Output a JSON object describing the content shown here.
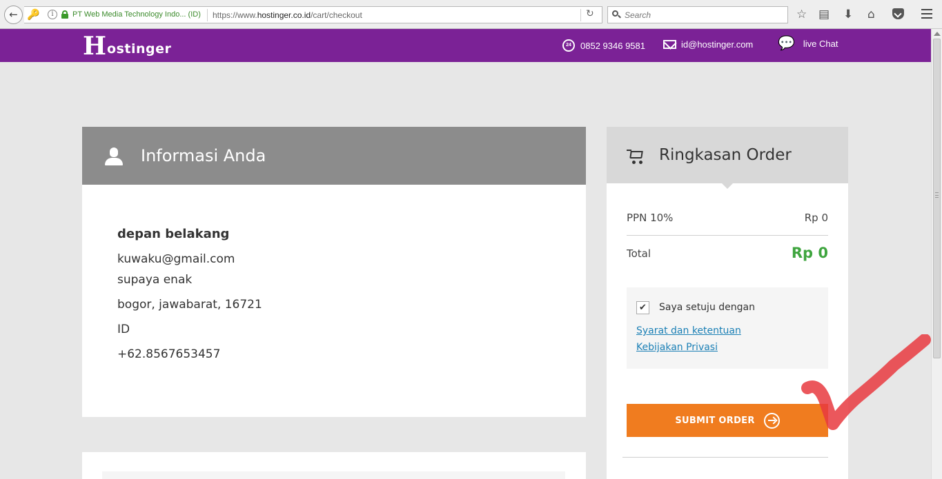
{
  "browser": {
    "site_identity": "PT Web Media Technology Indo... (ID)",
    "url_prefix": "https://www.",
    "url_domain": "hostinger.co.id",
    "url_path": "/cart/checkout",
    "search_placeholder": "Search"
  },
  "header": {
    "logo_mark": "H",
    "logo_text": "ostinger",
    "phone_badge": "24",
    "phone": "0852 9346 9581",
    "email": "id@hostinger.com",
    "chat": "live Chat",
    "brand_color": "#7b2296"
  },
  "info": {
    "title": "Informasi Anda",
    "name": "depan belakang",
    "email": "kuwaku@gmail.com",
    "address": "supaya enak",
    "city_line": "bogor, jawabarat, 16721",
    "country": "ID",
    "phone": "+62.8567653457"
  },
  "summary": {
    "title": "Ringkasan Order",
    "ppn_label": "PPN 10%",
    "ppn_value": "Rp 0",
    "total_label": "Total",
    "total_value": "Rp 0",
    "total_color": "#3fa53f",
    "agree_text": "Saya setuju dengan",
    "terms_link": "Syarat dan ketentuan",
    "privacy_link": "Kebijakan Privasi",
    "agreed": true,
    "submit_label": "SUBMIT ORDER",
    "submit_color": "#f07c1f"
  }
}
